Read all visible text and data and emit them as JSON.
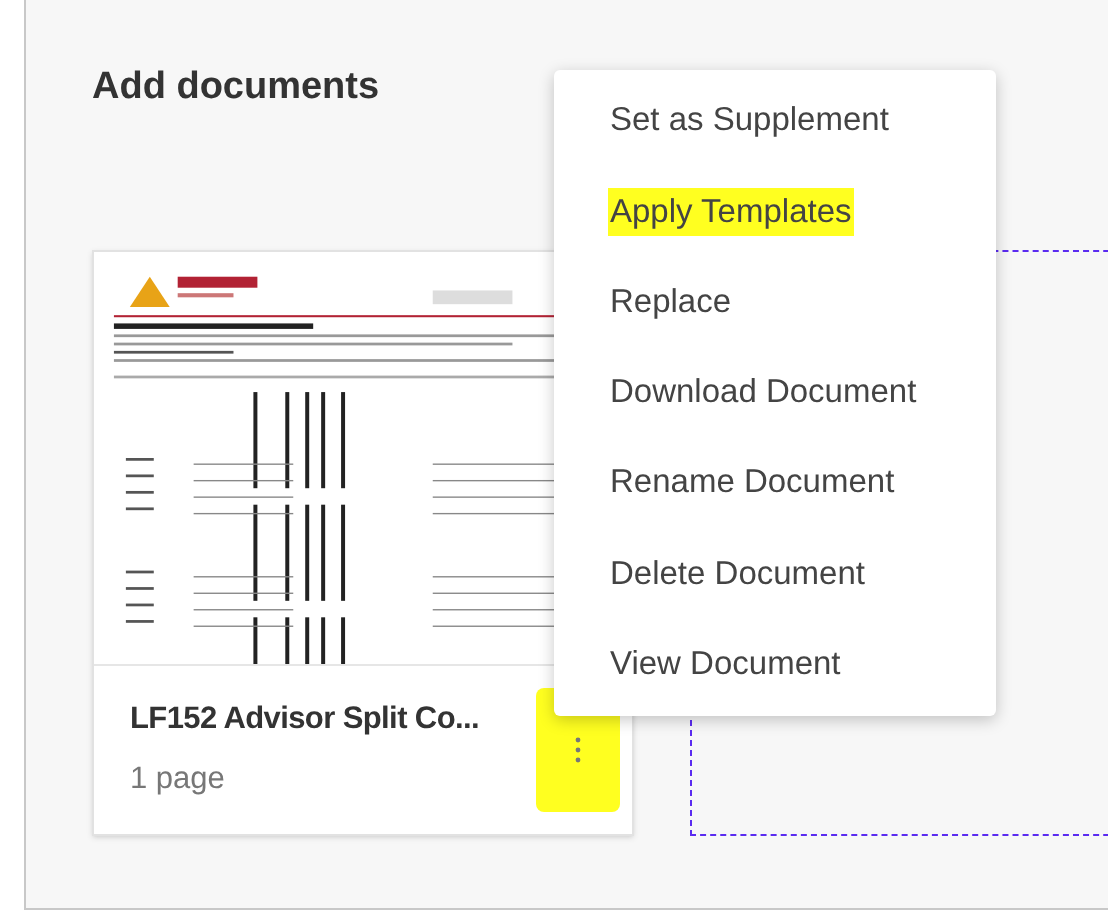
{
  "panel": {
    "title": "Add documents"
  },
  "document": {
    "name": "LF152 Advisor Split Co...",
    "pages": "1 page",
    "more_highlighted": true
  },
  "menu": {
    "items": [
      {
        "label": "Set as Supplement",
        "highlighted": false
      },
      {
        "label": "Apply Templates",
        "highlighted": true
      },
      {
        "label": "Replace",
        "highlighted": false
      },
      {
        "label": "Download Document",
        "highlighted": false
      },
      {
        "label": "Rename Document",
        "highlighted": false
      },
      {
        "label": "Delete Document",
        "highlighted": false
      },
      {
        "label": "View Document",
        "highlighted": false
      }
    ]
  }
}
